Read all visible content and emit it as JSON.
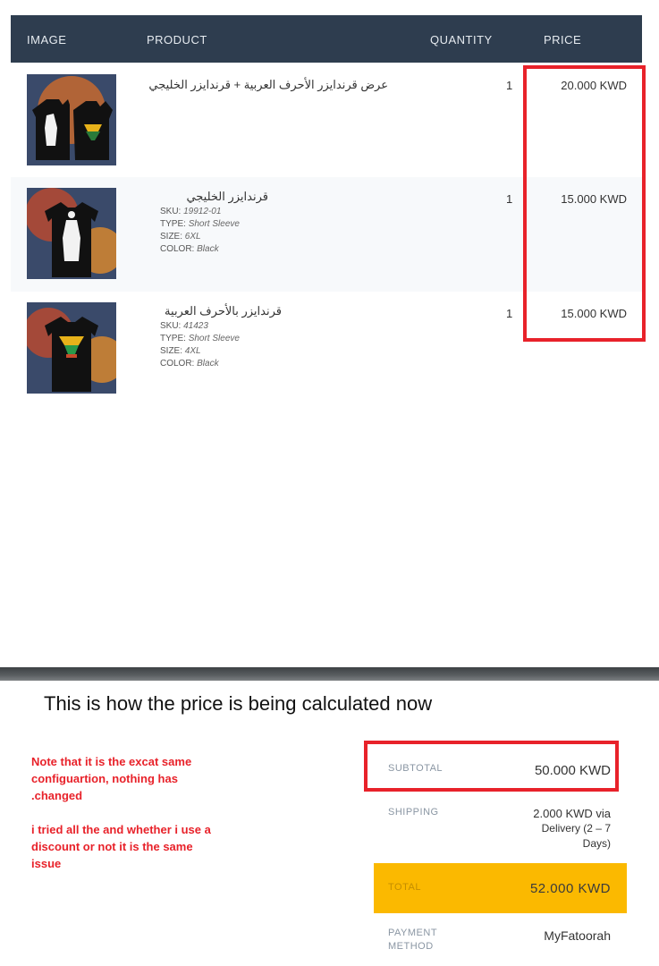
{
  "table": {
    "headers": {
      "image": "IMAGE",
      "product": "PRODUCT",
      "quantity": "QUANTITY",
      "price": "PRICE"
    },
    "rows": [
      {
        "name": "عرض قرندايزر الأحرف العربية + قرندايزر الخليجي",
        "quantity": "1",
        "price": "20.000 KWD"
      },
      {
        "name": "قرندايزر الخليجي",
        "sku_label": "SKU:",
        "sku": "19912-01",
        "type_label": "TYPE:",
        "type": "Short Sleeve",
        "size_label": "SIZE:",
        "size": "6XL",
        "color_label": "COLOR:",
        "color": "Black",
        "quantity": "1",
        "price": "15.000 KWD"
      },
      {
        "name": "قرندايزر بالأحرف العربية",
        "sku_label": "SKU:",
        "sku": "41423",
        "type_label": "TYPE:",
        "type": "Short Sleeve",
        "size_label": "SIZE:",
        "size": "4XL",
        "color_label": "COLOR:",
        "color": "Black",
        "quantity": "1",
        "price": "15.000 KWD"
      }
    ]
  },
  "heading": "This is how the price is being calculated now",
  "note": {
    "line1": "Note that it is the excat same",
    "line2": "configuartion, nothing has",
    "line3": ".changed",
    "line4": "i tried all the and whether i use a",
    "line5": "discount or not it is the same",
    "line6": "issue"
  },
  "totals": {
    "subtotal_label": "SUBTOTAL",
    "subtotal_value": "50.000 KWD",
    "shipping_label": "SHIPPING",
    "shipping_value_line1": "2.000 KWD via",
    "shipping_value_line2": "Delivery (2 – 7",
    "shipping_value_line3": "Days)",
    "total_label": "TOTAL",
    "total_value": "52.000 KWD",
    "payment_label_line1": "PAYMENT",
    "payment_label_line2": "METHOD",
    "payment_value": "MyFatoorah"
  },
  "colors": {
    "header_bg": "#2e3d4f",
    "highlight": "#e8222a",
    "total_bg": "#fbb900"
  }
}
